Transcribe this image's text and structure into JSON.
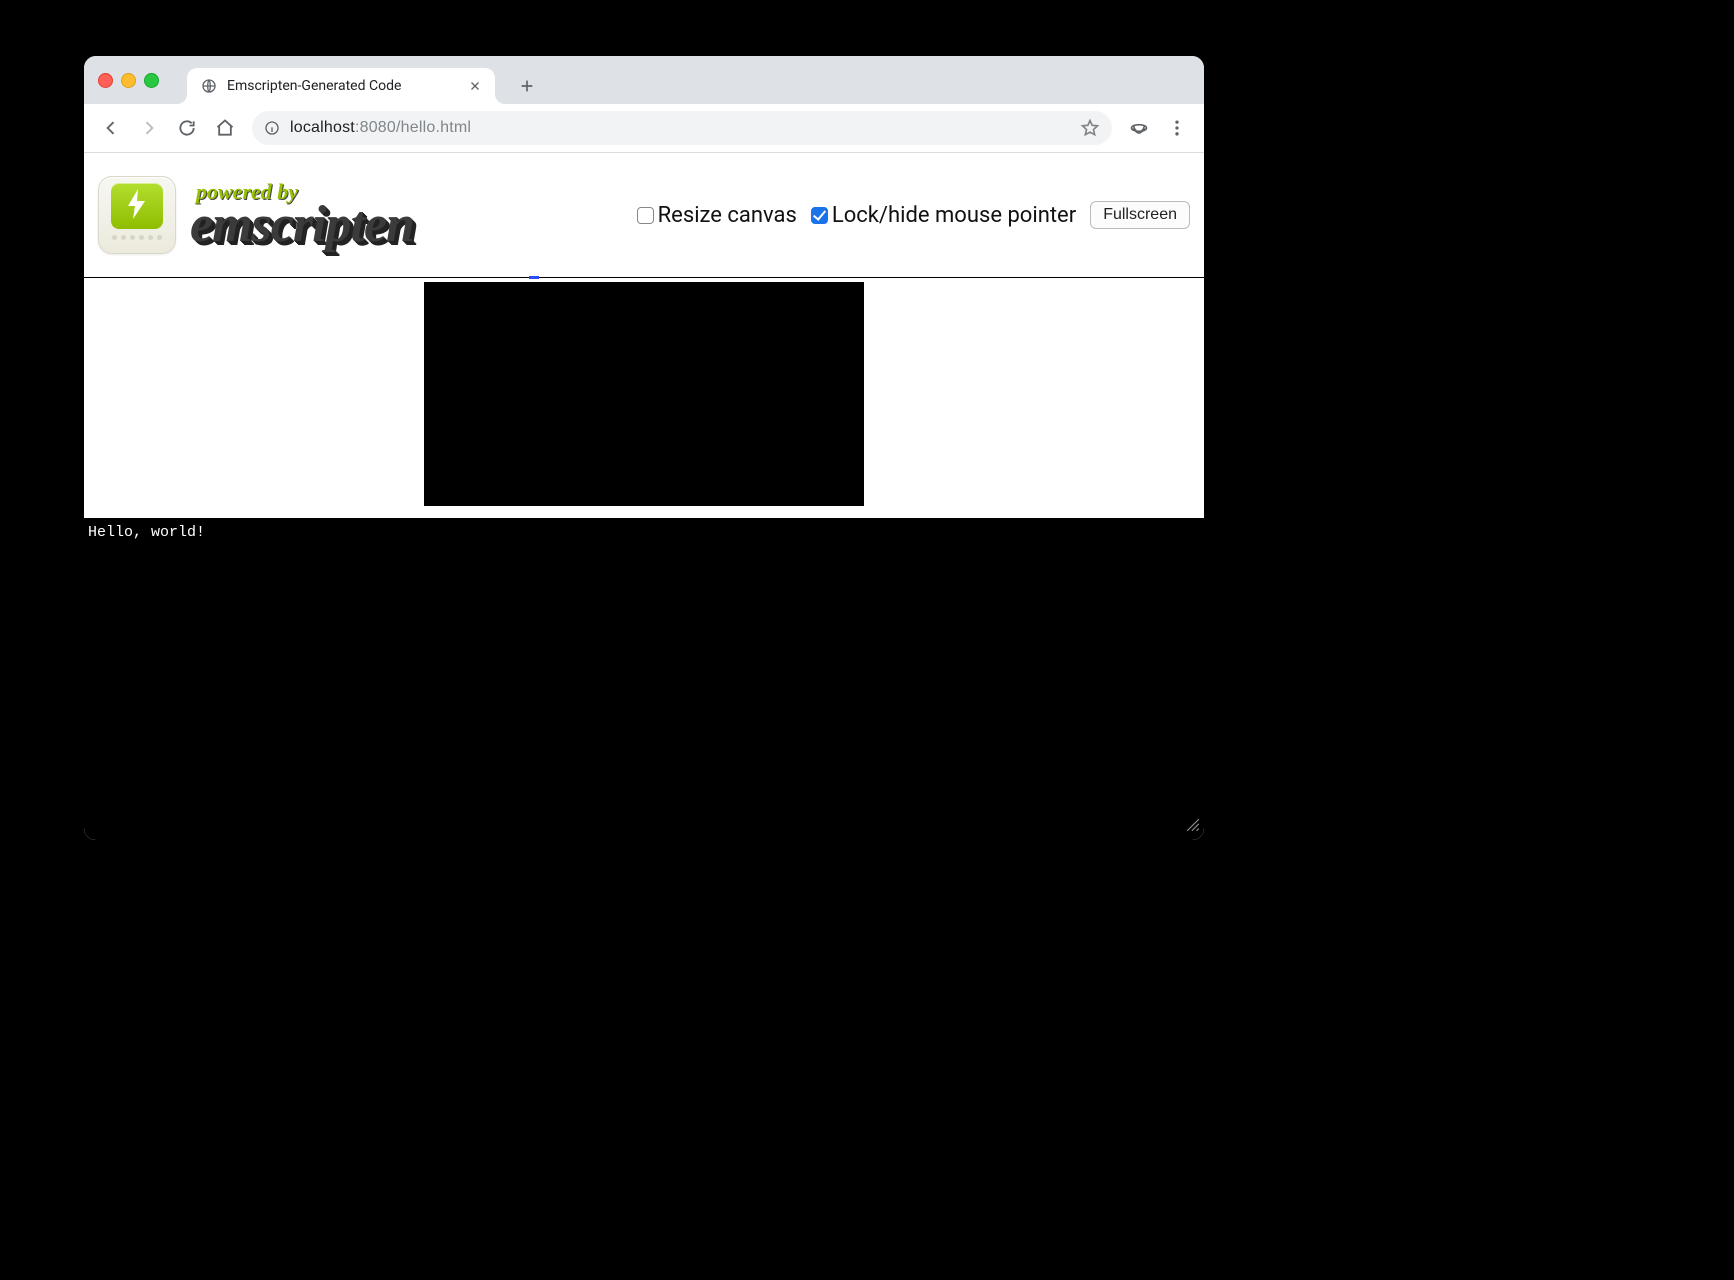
{
  "browser": {
    "tab_title": "Emscripten-Generated Code",
    "url_host": "localhost",
    "url_port": ":8080",
    "url_path": "/hello.html"
  },
  "header": {
    "powered_by": "powered by",
    "brand": "emscripten"
  },
  "controls": {
    "resize_label": "Resize canvas",
    "resize_checked": false,
    "lock_label": "Lock/hide mouse pointer",
    "lock_checked": true,
    "fullscreen_label": "Fullscreen"
  },
  "output": {
    "text": "Hello, world!"
  }
}
